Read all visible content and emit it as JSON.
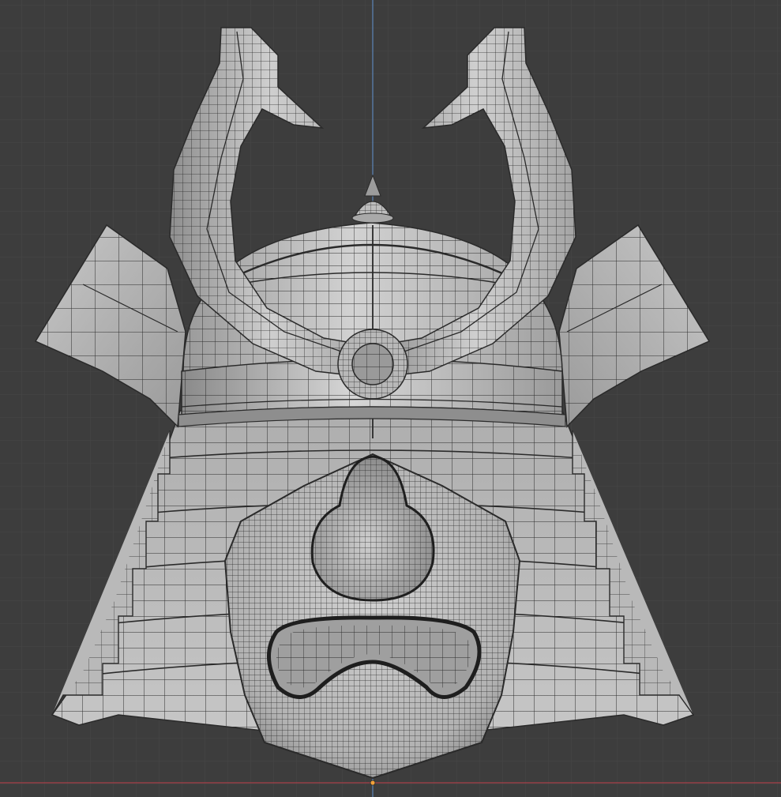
{
  "viewport": {
    "background": "#3d3d3d",
    "grid_minor_color": "#434343",
    "grid_major_color": "#4a4a4a",
    "z_axis_color": "#5c86b8",
    "x_axis_color": "#a8404a",
    "origin_color": "#f2a13a"
  },
  "mesh": {
    "object": "samurai-kabuto-helmet",
    "shading": "solid-wireframe",
    "surface_light": "#c9c9c9",
    "surface_mid": "#a6a6a6",
    "surface_dark": "#7d7d7d",
    "wire_color": "#2a2a2a"
  }
}
